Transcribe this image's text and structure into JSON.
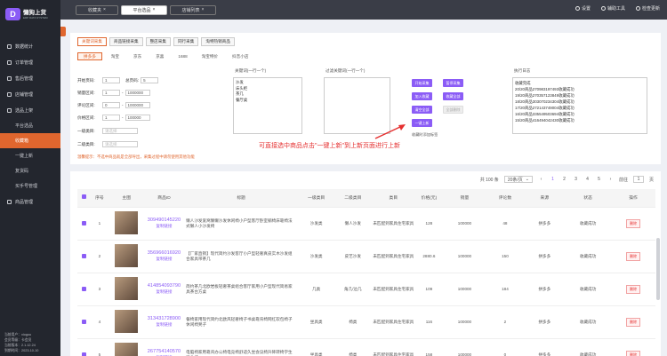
{
  "app": {
    "name": "懒狗上货",
    "sub": "ERP DATA SYSTEM"
  },
  "sidebar": {
    "items": [
      {
        "label": "数据统计",
        "icon": "chart-icon"
      },
      {
        "label": "订单管理",
        "icon": "order-icon"
      },
      {
        "label": "售后管理",
        "icon": "aftersale-icon"
      },
      {
        "label": "店铺管理",
        "icon": "shop-icon"
      },
      {
        "label": "选品上架",
        "icon": "select-icon"
      }
    ],
    "subitems": [
      "平台选品",
      "收藏箱",
      "一键上新",
      "复货码",
      "买手号管理"
    ],
    "active_sub": 1,
    "last_item": {
      "label": "商品管理",
      "icon": "goods-icon"
    },
    "footer": [
      "当前用户：xiogou",
      "会员等级：卡会员",
      "当前版本：2.1.12.24",
      "到期时间：2023-10-10"
    ]
  },
  "topbar": {
    "btn1": "收藏夹",
    "btn2": "平台选品",
    "btn3": "店铺列表",
    "right": [
      "设置",
      "辅助工具",
      "检查更新"
    ]
  },
  "panel1": {
    "tabs": [
      "关键词采集",
      "商品链接采集",
      "整店采集",
      "同行采集",
      "淘特热销商品"
    ],
    "platforms": [
      "拼多多",
      "淘宝",
      "京东",
      "京喜",
      "1688",
      "淘宝特价",
      "抖音小店"
    ],
    "filters": [
      {
        "label": "开始页码:",
        "a": "1",
        "b_label": "总页码:",
        "b": "5"
      },
      {
        "label": "销量区间:",
        "a": "1",
        "b": "1000000"
      },
      {
        "label": "评论区间:",
        "a": "0",
        "b": "1000000"
      },
      {
        "label": "价格区间:",
        "a": "1",
        "b": "100000"
      }
    ],
    "cat1_label": "一级类目:",
    "cat1_ph": "请选择",
    "cat2_label": "二级类目:",
    "cat2_ph": "请选择",
    "tip": "温馨提示：不选中商品就是全部导出，采集过程中请勿使用其他功能",
    "keywords_label": "关键词(一行一个)",
    "keywords": [
      "沙发",
      "床头柜",
      "茶几",
      "餐厅桌"
    ],
    "filter_label": "过滤关键词(一行一个)",
    "buttons": [
      "开始采集",
      "暂停采集",
      "加入收藏",
      "收藏全部",
      "清空全部",
      "全部删除",
      "一键上新"
    ],
    "collect_note": "收藏时添加标签",
    "log_label": "执行日志",
    "log": [
      "收藏完成",
      "20/20商品270983197493收藏成功",
      "19/20商品270357123849收藏成功",
      "18/20商品303070234304收藏成功",
      "17/20商品272143749004收藏成功",
      "16/20商品335549503694收藏成功",
      "15/20商品416494042430收藏成功"
    ]
  },
  "annotation": "可直接选中商品点击\"一键上新\"到上新页面进行上新",
  "table": {
    "total": "共 100 条",
    "page_size": "20条/页",
    "pages": [
      "1",
      "2",
      "3",
      "4",
      "5"
    ],
    "goto_label": "前往",
    "goto_value": "1",
    "goto_suffix": "页",
    "headers": [
      "序号",
      "主图",
      "商品ID",
      "标题",
      "一级类目",
      "二级类目",
      "类目",
      "价格(元)",
      "销量",
      "评论数",
      "来源",
      "状态",
      "操作"
    ],
    "copy_label": "复制链接",
    "delete_label": "删除",
    "rows": [
      {
        "no": "1",
        "id": "309490145220",
        "title": "懒人沙发爱窝懒懒沙发休闲椅小户型客厅卧室躺椅床靠椅法式懒人小沙发椅",
        "c1": "沙发类",
        "c2": "懒人沙发",
        "cat": "未匹配到家具住宅家具",
        "price": "128",
        "sales": "100000",
        "comments": "48",
        "src": "拼多多",
        "status": "收藏成功"
      },
      {
        "no": "2",
        "id": "356966016920",
        "title": "【厂家直销】现代简约沙发客厅小户型轻奢真皮实木沙发组合家具带茶几",
        "c1": "沙发类",
        "c2": "皮艺沙发",
        "cat": "未匹配到家具住宅家具",
        "price": "2880.6",
        "sales": "100000",
        "comments": "150",
        "src": "拼多多",
        "status": "收藏成功"
      },
      {
        "no": "3",
        "id": "414854093790",
        "title": "简约茶几北欧岩板轻奢茶桌组合客厅家用小户型现代简易家具茶台方桌",
        "c1": "几类",
        "c2": "角几/边几",
        "cat": "未匹配到家具住宅家具",
        "price": "109",
        "sales": "100000",
        "comments": "184",
        "src": "拼多多",
        "status": "收藏成功"
      },
      {
        "no": "4",
        "id": "313431728900",
        "title": "餐椅家用现代简约北欧风轻奢椅子书桌靠背椅网红软包椅子休闲椅凳子",
        "c1": "坐具类",
        "c2": "椅类",
        "cat": "未匹配到家具住宅家具",
        "price": "116",
        "sales": "100000",
        "comments": "2",
        "src": "拼多多",
        "status": "收藏成功"
      },
      {
        "no": "5",
        "id": "267754140570",
        "title": "电脑椅家用靠背办公椅电竞椅舒适久坐会议椅升降转椅学生宿舍椅",
        "c1": "坐具类",
        "c2": "椅类",
        "cat": "未匹配到家具住宅家具",
        "price": "158",
        "sales": "100000",
        "comments": "0",
        "src": "拼多多",
        "status": "收藏成功"
      }
    ]
  },
  "colors": {
    "accent": "#e0662e",
    "primary": "#8b5cf6",
    "sidebar": "#23262e"
  }
}
